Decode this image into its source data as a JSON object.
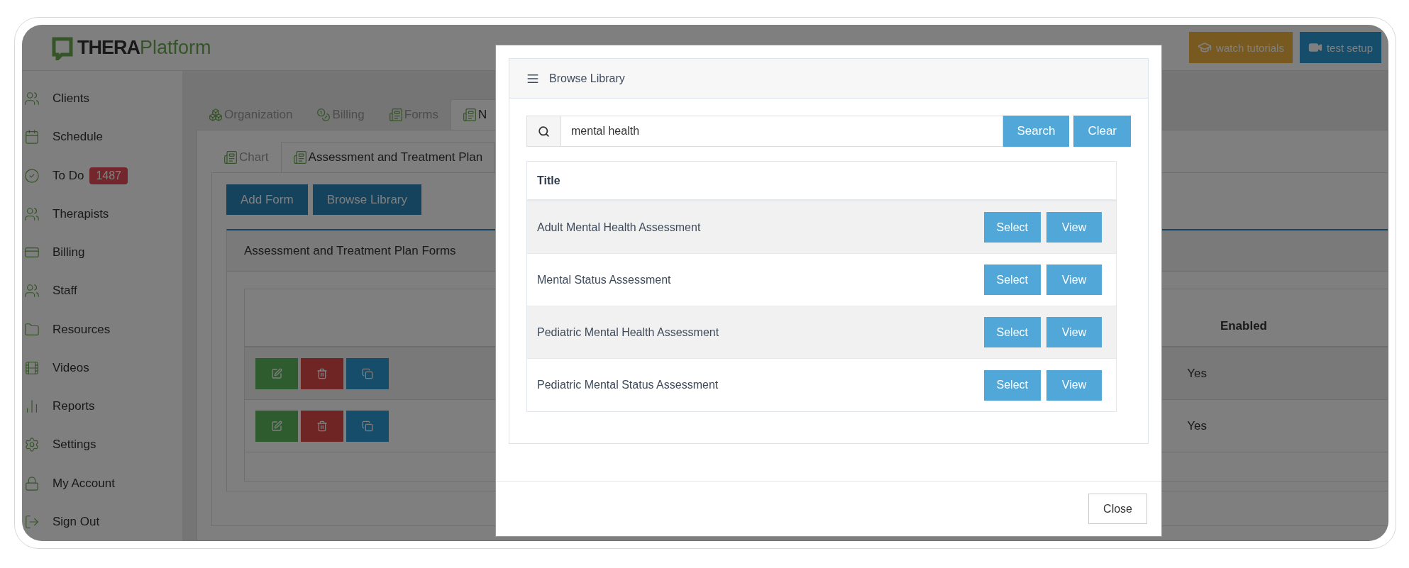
{
  "logo": {
    "bold": "THERA",
    "light": "Platform"
  },
  "header_buttons": [
    {
      "label": "watch tutorials",
      "kind": "tutorials"
    },
    {
      "label": "test setup",
      "kind": "setup"
    }
  ],
  "sidebar": {
    "items": [
      {
        "label": "Clients"
      },
      {
        "label": "Schedule"
      },
      {
        "label": "To Do",
        "badge": "1487"
      },
      {
        "label": "Therapists"
      },
      {
        "label": "Billing"
      },
      {
        "label": "Staff"
      },
      {
        "label": "Resources"
      },
      {
        "label": "Videos"
      },
      {
        "label": "Reports"
      },
      {
        "label": "Settings"
      },
      {
        "label": "My Account"
      },
      {
        "label": "Sign Out"
      }
    ]
  },
  "tabs": [
    {
      "label": "Organization",
      "selected": false
    },
    {
      "label": "Billing",
      "selected": false
    },
    {
      "label": "Forms",
      "selected": false
    },
    {
      "label": "N",
      "selected": true
    }
  ],
  "subtabs": [
    {
      "label": "Chart",
      "selected": false
    },
    {
      "label": "Assessment and Treatment Plan",
      "selected": true
    }
  ],
  "actions": [
    "Add Form",
    "Browse Library"
  ],
  "forms_panel": {
    "title": "Assessment and Treatment Plan Forms",
    "column": "Enabled",
    "rows": [
      {
        "enabled": "Yes"
      },
      {
        "enabled": "Yes"
      }
    ]
  },
  "modal": {
    "title": "Browse Library",
    "search": {
      "value": "mental health"
    },
    "search_buttons": [
      "Search",
      "Clear"
    ],
    "column": "Title",
    "rows": [
      {
        "title": "Adult Mental Health Assessment",
        "buttons": [
          "Select",
          "View"
        ]
      },
      {
        "title": "Mental Status Assessment",
        "buttons": [
          "Select",
          "View"
        ]
      },
      {
        "title": "Pediatric Mental Health Assessment",
        "buttons": [
          "Select",
          "View"
        ]
      },
      {
        "title": "Pediatric Mental Status Assessment",
        "buttons": [
          "Select",
          "View"
        ]
      }
    ],
    "close": "Close"
  }
}
